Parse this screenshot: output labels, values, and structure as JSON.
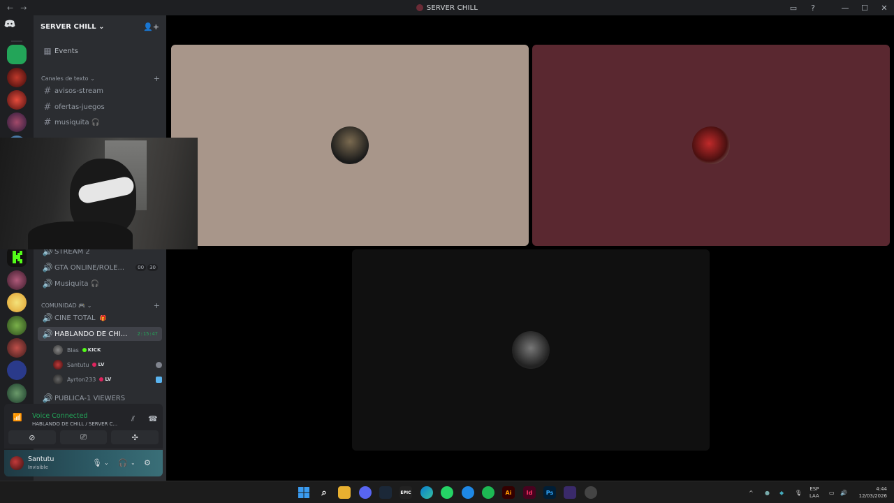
{
  "window": {
    "title": "SERVER CHILL",
    "nav_back": "←",
    "nav_forward": "→"
  },
  "server": {
    "name": "SERVER CHILL ⌄"
  },
  "channels": {
    "events": "Events",
    "text_category": "Canales de texto ⌄",
    "text_items": [
      "avisos-stream",
      "ofertas-juegos",
      "musiquita 🎧"
    ],
    "voice_items": [
      {
        "name": "STREAM 2"
      },
      {
        "name": "GTA ONLINE/ROLE...",
        "badge1": "00",
        "badge2": "30"
      },
      {
        "name": "Musiquita 🎧"
      }
    ],
    "community_category": "COMUNIDAD",
    "community_items": [
      {
        "name": "CINE TOTAL"
      },
      {
        "name": "HABLANDO DE CHI...",
        "timer": "2:15:47"
      }
    ],
    "voice_users": [
      {
        "name": "Blas",
        "tag": "KICK",
        "tag_color": "#53fc18"
      },
      {
        "name": "Santutu",
        "tag": "LV",
        "tag_color": "#e0245e"
      },
      {
        "name": "Ayrton233",
        "tag": "LV",
        "tag_color": "#e0245e"
      }
    ],
    "last_channel": "PUBLICA-1 VIEWERS"
  },
  "voice_panel": {
    "status": "Voice Connected",
    "path": "HABLANDO DE CHILL / SERVER C..."
  },
  "user_panel": {
    "username": "Santutu",
    "status": "Invisible"
  },
  "stage": {
    "tiles": [
      {
        "bg": "#a8968a"
      },
      {
        "bg": "#5a2830"
      },
      {
        "bg": "#101010"
      }
    ]
  },
  "taskbar": {
    "lang_line1": "ESP",
    "lang_line2": "LAA",
    "time": "4:44",
    "date": "12/03/2026"
  },
  "icons": {
    "discord": "discord-icon",
    "search": "search-icon",
    "settings": "gear-icon"
  },
  "colors": {
    "accent_green": "#23a559",
    "sidebar_bg": "#2b2d31",
    "rail_bg": "#1e1f22"
  }
}
